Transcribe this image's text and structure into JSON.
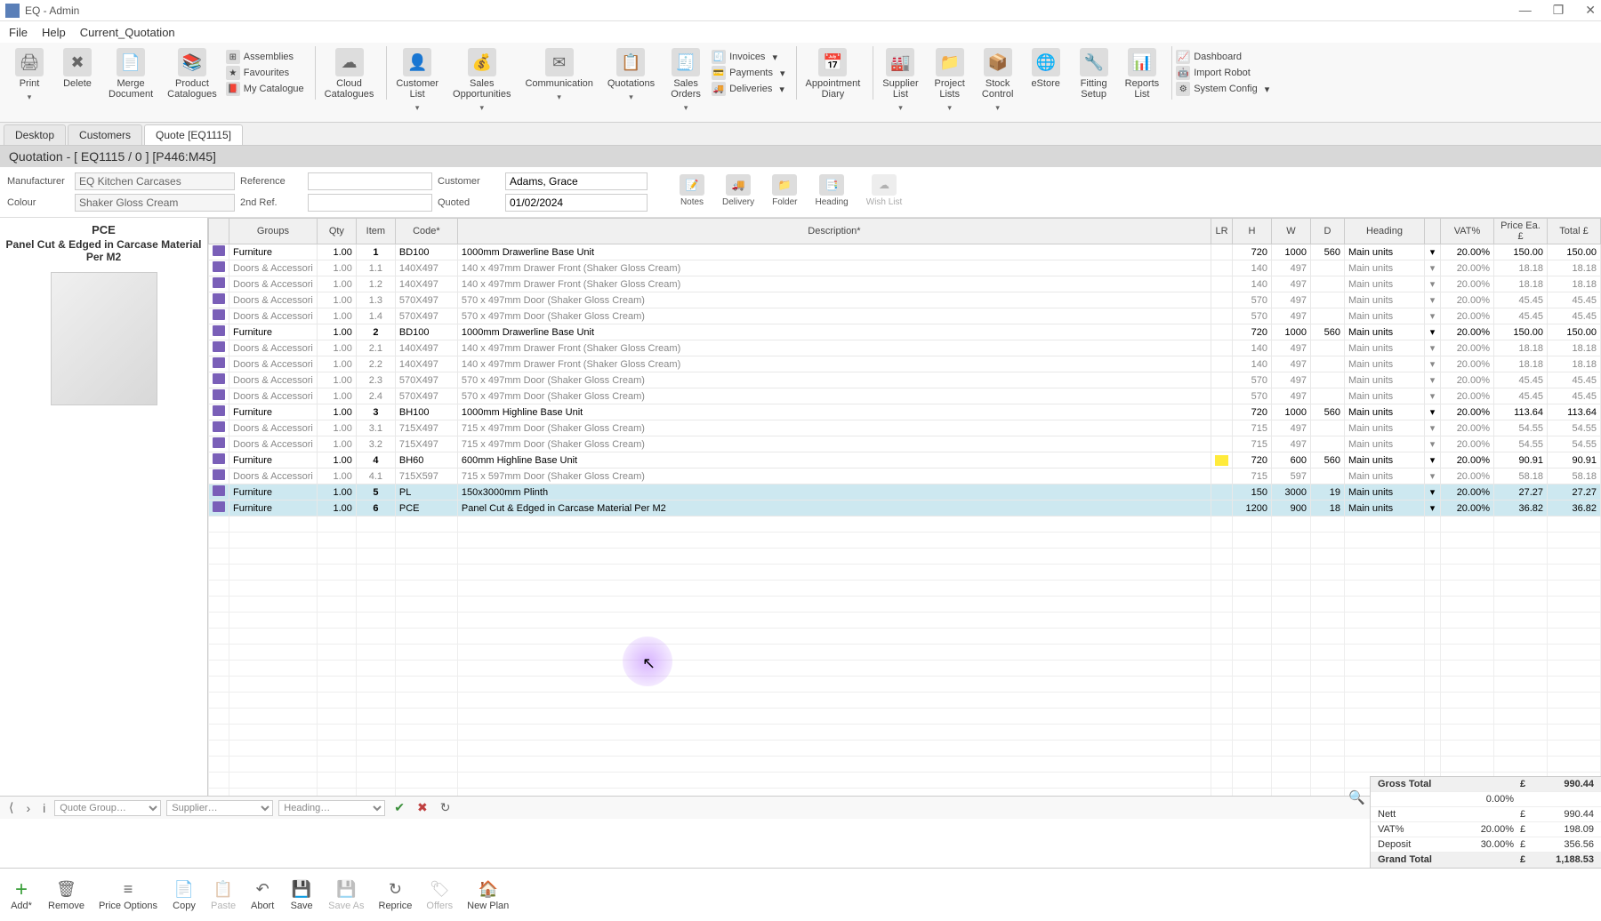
{
  "app": {
    "title": "EQ  -  Admin"
  },
  "window": {
    "min": "—",
    "max": "❐",
    "close": "✕"
  },
  "menu": {
    "file": "File",
    "help": "Help",
    "current": "Current_Quotation"
  },
  "ribbon": {
    "print": "Print",
    "delete": "Delete",
    "merge": "Merge\nDocument",
    "prodcat": "Product\nCatalogues",
    "assemblies": "Assemblies",
    "favourites": "Favourites",
    "mycat": "My Catalogue",
    "cloudcat": "Cloud\nCatalogues",
    "custlist": "Customer\nList",
    "salesopp": "Sales\nOpportunities",
    "comm": "Communication",
    "quotations": "Quotations",
    "salesorders": "Sales\nOrders",
    "invoices": "Invoices",
    "payments": "Payments",
    "deliveries": "Deliveries",
    "apptdiary": "Appointment\nDiary",
    "supplist": "Supplier\nList",
    "projlists": "Project\nLists",
    "stockctl": "Stock\nControl",
    "estore": "eStore",
    "fitsetup": "Fitting\nSetup",
    "reports": "Reports\nList",
    "dashboard": "Dashboard",
    "robot": "Import Robot",
    "sysconfig": "System Config"
  },
  "tabs": {
    "desktop": "Desktop",
    "customers": "Customers",
    "quote": "Quote [EQ1115]"
  },
  "quote_header": "Quotation - [ EQ1115 / 0 ]    [P446:M45]",
  "form": {
    "manufacturer_lbl": "Manufacturer",
    "manufacturer": "EQ Kitchen Carcases",
    "colour_lbl": "Colour",
    "colour": "Shaker Gloss Cream",
    "reference_lbl": "Reference",
    "reference": "",
    "ref2_lbl": "2nd Ref.",
    "ref2": "",
    "customer_lbl": "Customer",
    "customer": "Adams, Grace",
    "quoted_lbl": "Quoted",
    "quoted": "01/02/2024"
  },
  "formtb": {
    "notes": "Notes",
    "delivery": "Delivery",
    "folder": "Folder",
    "heading": "Heading",
    "wishlist": "Wish List"
  },
  "preview": {
    "code": "PCE",
    "desc": "Panel Cut & Edged in Carcase Material Per M2"
  },
  "grid": {
    "cols": {
      "groups": "Groups",
      "qty": "Qty",
      "item": "Item",
      "code": "Code*",
      "desc": "Description*",
      "lr": "LR",
      "h": "H",
      "w": "W",
      "d": "D",
      "heading": "Heading",
      "vat": "VAT%",
      "price": "Price Ea. £",
      "total": "Total £"
    },
    "rows": [
      {
        "t": "m",
        "grp": "Furniture",
        "qty": "1.00",
        "item": "1",
        "code": "BD100",
        "desc": "1000mm Drawerline Base Unit",
        "h": "720",
        "w": "1000",
        "d": "560",
        "head": "Main units",
        "vat": "20.00%",
        "pe": "150.00",
        "tot": "150.00"
      },
      {
        "t": "s",
        "grp": "Doors & Accessori",
        "qty": "1.00",
        "item": "1.1",
        "code": "140X497",
        "desc": "140 x 497mm Drawer Front (Shaker Gloss Cream)",
        "h": "140",
        "w": "497",
        "d": "",
        "head": "Main units",
        "vat": "20.00%",
        "pe": "18.18",
        "tot": "18.18"
      },
      {
        "t": "s",
        "grp": "Doors & Accessori",
        "qty": "1.00",
        "item": "1.2",
        "code": "140X497",
        "desc": "140 x 497mm Drawer Front (Shaker Gloss Cream)",
        "h": "140",
        "w": "497",
        "d": "",
        "head": "Main units",
        "vat": "20.00%",
        "pe": "18.18",
        "tot": "18.18"
      },
      {
        "t": "s",
        "grp": "Doors & Accessori",
        "qty": "1.00",
        "item": "1.3",
        "code": "570X497",
        "desc": "570 x 497mm Door (Shaker Gloss Cream)",
        "h": "570",
        "w": "497",
        "d": "",
        "head": "Main units",
        "vat": "20.00%",
        "pe": "45.45",
        "tot": "45.45"
      },
      {
        "t": "s",
        "grp": "Doors & Accessori",
        "qty": "1.00",
        "item": "1.4",
        "code": "570X497",
        "desc": "570 x 497mm Door (Shaker Gloss Cream)",
        "h": "570",
        "w": "497",
        "d": "",
        "head": "Main units",
        "vat": "20.00%",
        "pe": "45.45",
        "tot": "45.45"
      },
      {
        "t": "m",
        "grp": "Furniture",
        "qty": "1.00",
        "item": "2",
        "code": "BD100",
        "desc": "1000mm Drawerline Base Unit",
        "h": "720",
        "w": "1000",
        "d": "560",
        "head": "Main units",
        "vat": "20.00%",
        "pe": "150.00",
        "tot": "150.00"
      },
      {
        "t": "s",
        "grp": "Doors & Accessori",
        "qty": "1.00",
        "item": "2.1",
        "code": "140X497",
        "desc": "140 x 497mm Drawer Front (Shaker Gloss Cream)",
        "h": "140",
        "w": "497",
        "d": "",
        "head": "Main units",
        "vat": "20.00%",
        "pe": "18.18",
        "tot": "18.18"
      },
      {
        "t": "s",
        "grp": "Doors & Accessori",
        "qty": "1.00",
        "item": "2.2",
        "code": "140X497",
        "desc": "140 x 497mm Drawer Front (Shaker Gloss Cream)",
        "h": "140",
        "w": "497",
        "d": "",
        "head": "Main units",
        "vat": "20.00%",
        "pe": "18.18",
        "tot": "18.18"
      },
      {
        "t": "s",
        "grp": "Doors & Accessori",
        "qty": "1.00",
        "item": "2.3",
        "code": "570X497",
        "desc": "570 x 497mm Door (Shaker Gloss Cream)",
        "h": "570",
        "w": "497",
        "d": "",
        "head": "Main units",
        "vat": "20.00%",
        "pe": "45.45",
        "tot": "45.45"
      },
      {
        "t": "s",
        "grp": "Doors & Accessori",
        "qty": "1.00",
        "item": "2.4",
        "code": "570X497",
        "desc": "570 x 497mm Door (Shaker Gloss Cream)",
        "h": "570",
        "w": "497",
        "d": "",
        "head": "Main units",
        "vat": "20.00%",
        "pe": "45.45",
        "tot": "45.45"
      },
      {
        "t": "m",
        "grp": "Furniture",
        "qty": "1.00",
        "item": "3",
        "code": "BH100",
        "desc": "1000mm Highline Base Unit",
        "h": "720",
        "w": "1000",
        "d": "560",
        "head": "Main units",
        "vat": "20.00%",
        "pe": "113.64",
        "tot": "113.64"
      },
      {
        "t": "s",
        "grp": "Doors & Accessori",
        "qty": "1.00",
        "item": "3.1",
        "code": "715X497",
        "desc": "715 x 497mm Door (Shaker Gloss Cream)",
        "h": "715",
        "w": "497",
        "d": "",
        "head": "Main units",
        "vat": "20.00%",
        "pe": "54.55",
        "tot": "54.55"
      },
      {
        "t": "s",
        "grp": "Doors & Accessori",
        "qty": "1.00",
        "item": "3.2",
        "code": "715X497",
        "desc": "715 x 497mm Door (Shaker Gloss Cream)",
        "h": "715",
        "w": "497",
        "d": "",
        "head": "Main units",
        "vat": "20.00%",
        "pe": "54.55",
        "tot": "54.55"
      },
      {
        "t": "m",
        "grp": "Furniture",
        "qty": "1.00",
        "item": "4",
        "code": "BH60",
        "desc": "600mm Highline Base Unit",
        "h": "720",
        "w": "600",
        "d": "560",
        "head": "Main units",
        "vat": "20.00%",
        "pe": "90.91",
        "tot": "90.91",
        "hl": true
      },
      {
        "t": "s",
        "grp": "Doors & Accessori",
        "qty": "1.00",
        "item": "4.1",
        "code": "715X597",
        "desc": "715 x 597mm Door (Shaker Gloss Cream)",
        "h": "715",
        "w": "597",
        "d": "",
        "head": "Main units",
        "vat": "20.00%",
        "pe": "58.18",
        "tot": "58.18"
      },
      {
        "t": "m",
        "sel": true,
        "grp": "Furniture",
        "qty": "1.00",
        "item": "5",
        "code": "PL",
        "desc": "150x3000mm Plinth",
        "h": "150",
        "w": "3000",
        "d": "19",
        "head": "Main units",
        "vat": "20.00%",
        "pe": "27.27",
        "tot": "27.27"
      },
      {
        "t": "m",
        "sel": true,
        "grp": "Furniture",
        "qty": "1.00",
        "item": "6",
        "code": "PCE",
        "desc": "Panel Cut & Edged in Carcase Material Per M2",
        "h": "1200",
        "w": "900",
        "d": "18",
        "head": "Main units",
        "vat": "20.00%",
        "pe": "36.82",
        "tot": "36.82",
        "red": true
      }
    ]
  },
  "nav": {
    "quotegroup": "Quote Group…",
    "supplier": "Supplier…",
    "heading": "Heading…"
  },
  "totals": {
    "gross_lbl": "Gross Total",
    "gross_c": "£",
    "gross": "990.44",
    "disc_pct": "0.00%",
    "nett_lbl": "Nett",
    "nett_c": "£",
    "nett": "990.44",
    "vat_lbl": "VAT%",
    "vat_pct": "20.00%",
    "vat_c": "£",
    "vat": "198.09",
    "dep_lbl": "Deposit",
    "dep_pct": "30.00%",
    "dep_c": "£",
    "dep": "356.56",
    "grand_lbl": "Grand Total",
    "grand_c": "£",
    "grand": "1,188.53"
  },
  "actions": {
    "add": "Add*",
    "remove": "Remove",
    "priceopt": "Price Options",
    "copy": "Copy",
    "paste": "Paste",
    "abort": "Abort",
    "save": "Save",
    "saveas": "Save As",
    "reprice": "Reprice",
    "offers": "Offers",
    "newplan": "New Plan"
  }
}
